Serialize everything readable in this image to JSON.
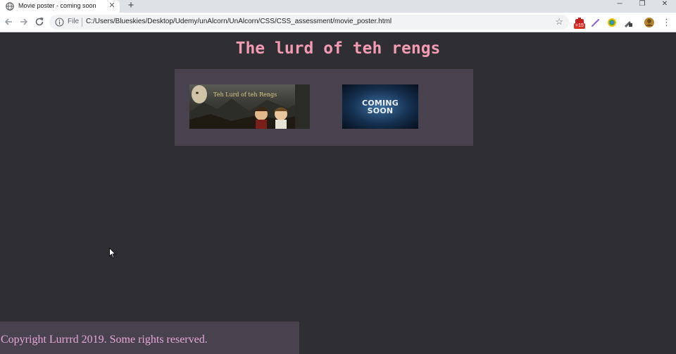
{
  "browser": {
    "tab": {
      "title": "Movie poster - coming soon",
      "close_glyph": "✕"
    },
    "new_tab_glyph": "+",
    "window_controls": {
      "minimize": "─",
      "restore": "❐",
      "close": "✕"
    },
    "address_bar": {
      "scheme_label": "File",
      "url": "C:/Users/Blueskies/Desktop/Udemy/unAlcorn/UnAlcorn/CSS/CSS_assessment/movie_poster.html",
      "bookmark_glyph": "☆"
    },
    "extensions": {
      "badge_text": "+15"
    },
    "menu_glyph": "⋮"
  },
  "page": {
    "title": "The lurd of teh rengs",
    "posters": [
      {
        "caption": "Teh Lurd of teh Rengs"
      },
      {
        "line1": "COMING",
        "line2": "SOON"
      }
    ],
    "footer": {
      "text": "Copyright Lurrrd 2019. Some rights reserved."
    }
  },
  "colors": {
    "page_background": "#2f2e33",
    "panel_background": "#48424f",
    "title_color": "#f29bb3",
    "footer_text_color": "#e7a6d9"
  }
}
